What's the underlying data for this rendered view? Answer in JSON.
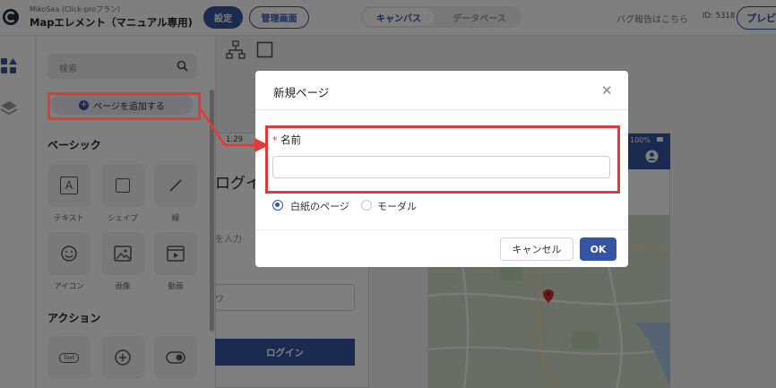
{
  "header": {
    "app_subtitle": "MikoSea (Click-proプラン)",
    "app_title": "Mapエレメント（マニュアル専用)",
    "settings_label": "設定",
    "admin_label": "管理画面",
    "tabs": [
      {
        "label": "キャンバス"
      },
      {
        "label": "データベース"
      }
    ],
    "bug_report_label": "バグ報告はこちら",
    "user_id": "ID: 5318",
    "preview_label": "プレビ"
  },
  "left_panel": {
    "search_placeholder": "検索",
    "add_page_label": "ページを追加する",
    "sections": [
      {
        "title": "ベーシック",
        "items": [
          {
            "label": "テキスト",
            "icon": "text-icon"
          },
          {
            "label": "シェイプ",
            "icon": "shape-icon"
          },
          {
            "label": "線",
            "icon": "line-icon"
          },
          {
            "label": "アイコン",
            "icon": "smiley-icon"
          },
          {
            "label": "画像",
            "icon": "image-icon"
          },
          {
            "label": "動画",
            "icon": "video-icon"
          }
        ]
      },
      {
        "title": "アクション",
        "items": [
          {
            "label": "",
            "icon": "text-button-icon",
            "glyph": "Text"
          },
          {
            "label": "",
            "icon": "plus-circle-icon"
          },
          {
            "label": "",
            "icon": "toggle-icon"
          }
        ]
      }
    ]
  },
  "canvas": {
    "phone1": {
      "time": "1:29",
      "login_title": "ログイ",
      "input_hint": "を入力",
      "password_hint": "ワ",
      "login_button": "ログイン"
    },
    "phone2": {
      "battery": "100%"
    }
  },
  "modal": {
    "title": "新規ページ",
    "required_mark": "*",
    "name_label": "名前",
    "name_value": "",
    "page_types": [
      {
        "label": "白紙のページ",
        "selected": true
      },
      {
        "label": "モーダル",
        "selected": false
      }
    ],
    "cancel_label": "キャンセル",
    "ok_label": "OK"
  },
  "colors": {
    "brand": "#3554a3",
    "annotation": "#e53935"
  }
}
